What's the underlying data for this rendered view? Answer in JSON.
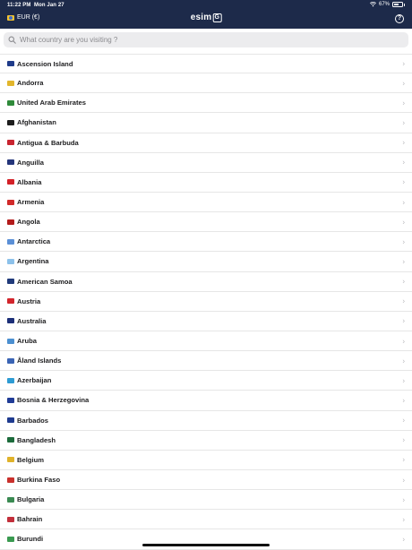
{
  "status": {
    "time": "11:22 PM",
    "date": "Mon Jan 27",
    "battery": "67%",
    "battery_level": 0.67
  },
  "header": {
    "currency": "EUR (€)",
    "logo_text": "esim",
    "logo_box": "G",
    "help_icon": "?"
  },
  "search": {
    "placeholder": "What country are you visiting ?",
    "value": ""
  },
  "colors": {
    "header_bg": "#1d2a4a",
    "search_bg": "#ececee",
    "chevron": "#b8b8bc"
  },
  "countries": [
    {
      "name": "Ascension Island",
      "flag_color": "#1f3b8a"
    },
    {
      "name": "Andorra",
      "flag_color": "#e2b62c"
    },
    {
      "name": "United Arab Emirates",
      "flag_color": "#2f8a3a"
    },
    {
      "name": "Afghanistan",
      "flag_color": "#1d1d1d"
    },
    {
      "name": "Antigua & Barbuda",
      "flag_color": "#c8242f"
    },
    {
      "name": "Anguilla",
      "flag_color": "#24357a"
    },
    {
      "name": "Albania",
      "flag_color": "#d32027"
    },
    {
      "name": "Armenia",
      "flag_color": "#d12a2a"
    },
    {
      "name": "Angola",
      "flag_color": "#b31b1b"
    },
    {
      "name": "Antarctica",
      "flag_color": "#5a8fd6"
    },
    {
      "name": "Argentina",
      "flag_color": "#8cc1ea"
    },
    {
      "name": "American Samoa",
      "flag_color": "#203a7a"
    },
    {
      "name": "Austria",
      "flag_color": "#d2252c"
    },
    {
      "name": "Australia",
      "flag_color": "#1c2f78"
    },
    {
      "name": "Aruba",
      "flag_color": "#4b8fd0"
    },
    {
      "name": "Åland Islands",
      "flag_color": "#3a64b4"
    },
    {
      "name": "Azerbaijan",
      "flag_color": "#2e9bd3"
    },
    {
      "name": "Bosnia & Herzegovina",
      "flag_color": "#203c96"
    },
    {
      "name": "Barbados",
      "flag_color": "#1f3b8f"
    },
    {
      "name": "Bangladesh",
      "flag_color": "#1c6b3b"
    },
    {
      "name": "Belgium",
      "flag_color": "#e0b22a"
    },
    {
      "name": "Burkina Faso",
      "flag_color": "#c9302c"
    },
    {
      "name": "Bulgaria",
      "flag_color": "#3a8a52"
    },
    {
      "name": "Bahrain",
      "flag_color": "#c22f3b"
    },
    {
      "name": "Burundi",
      "flag_color": "#3a9a50"
    }
  ]
}
